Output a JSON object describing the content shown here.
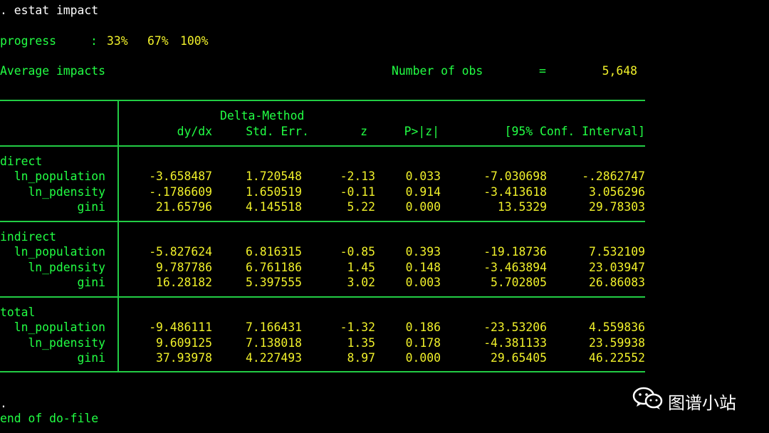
{
  "command": ". estat impact",
  "progress": {
    "label": "progress",
    "sep": ":",
    "steps": [
      "33%",
      "67%",
      "100%"
    ]
  },
  "summary": {
    "title": "Average impacts",
    "obs_label": "Number of obs",
    "eq": "=",
    "obs_value": "5,648"
  },
  "table": {
    "header_method": "Delta-Method",
    "columns": [
      "dy/dx",
      "Std. Err.",
      "z",
      "P>|z|",
      "[95% Conf. Interval]"
    ],
    "groups": [
      {
        "name": "direct",
        "rows": [
          {
            "var": "ln_population",
            "dydx": "-3.658487",
            "se": "1.720548",
            "z": "-2.13",
            "p": "0.033",
            "lo": "-7.030698",
            "hi": "-.2862747"
          },
          {
            "var": "ln_pdensity",
            "dydx": "-.1786609",
            "se": "1.650519",
            "z": "-0.11",
            "p": "0.914",
            "lo": "-3.413618",
            "hi": "3.056296"
          },
          {
            "var": "gini",
            "dydx": "21.65796",
            "se": "4.145518",
            "z": "5.22",
            "p": "0.000",
            "lo": "13.5329",
            "hi": "29.78303"
          }
        ]
      },
      {
        "name": "indirect",
        "rows": [
          {
            "var": "ln_population",
            "dydx": "-5.827624",
            "se": "6.816315",
            "z": "-0.85",
            "p": "0.393",
            "lo": "-19.18736",
            "hi": "7.532109"
          },
          {
            "var": "ln_pdensity",
            "dydx": "9.787786",
            "se": "6.761186",
            "z": "1.45",
            "p": "0.148",
            "lo": "-3.463894",
            "hi": "23.03947"
          },
          {
            "var": "gini",
            "dydx": "16.28182",
            "se": "5.397555",
            "z": "3.02",
            "p": "0.003",
            "lo": "5.702805",
            "hi": "26.86083"
          }
        ]
      },
      {
        "name": "total",
        "rows": [
          {
            "var": "ln_population",
            "dydx": "-9.486111",
            "se": "7.166431",
            "z": "-1.32",
            "p": "0.186",
            "lo": "-23.53206",
            "hi": "4.559836"
          },
          {
            "var": "ln_pdensity",
            "dydx": "9.609125",
            "se": "7.138018",
            "z": "1.35",
            "p": "0.178",
            "lo": "-4.381133",
            "hi": "23.59938"
          },
          {
            "var": "gini",
            "dydx": "37.93978",
            "se": "4.227493",
            "z": "8.97",
            "p": "0.000",
            "lo": "29.65405",
            "hi": "46.22552"
          }
        ]
      }
    ]
  },
  "footer": {
    "dot": ".",
    "end": "end of do-file"
  },
  "watermark": {
    "icon": "wechat-icon",
    "text": "图谱小站"
  },
  "colors": {
    "background": "#000000",
    "command": "#ffffff",
    "green": "#22ff44",
    "yellow": "#f0f02a",
    "rules": "#22cc44"
  }
}
